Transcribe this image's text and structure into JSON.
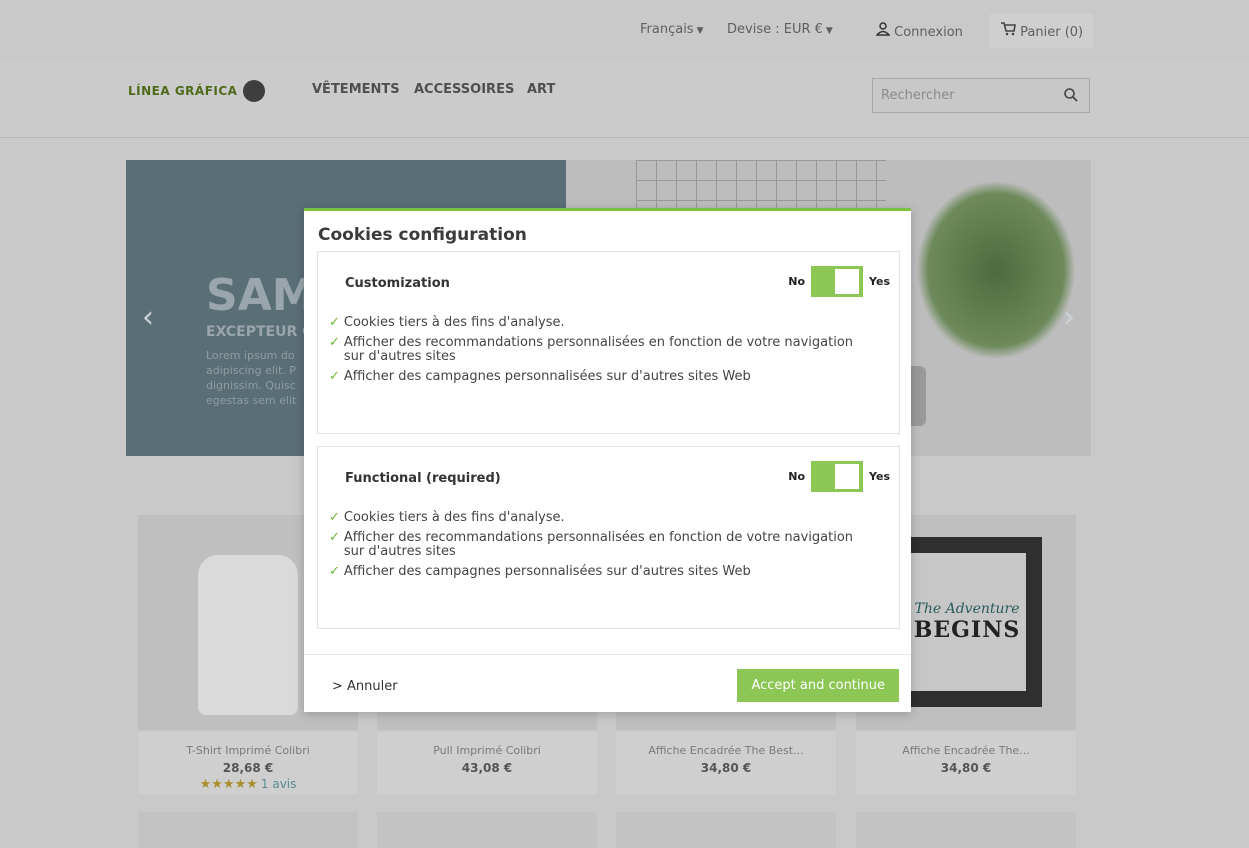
{
  "topbar": {
    "language": "Français",
    "currency": "Devise : EUR €",
    "login": "Connexion",
    "cart": "Panier (0)"
  },
  "header": {
    "logo_text": "LÍNEA GRÁFICA",
    "menu": [
      "VÊTEMENTS",
      "ACCESSOIRES",
      "ART"
    ],
    "search_placeholder": "Rechercher"
  },
  "hero": {
    "title": "SAM",
    "subtitle": "EXCEPTEUR C",
    "text": "Lorem ipsum do adipiscing elit. P dignissim. Quisc egestas sem elit"
  },
  "products": [
    {
      "name": "T-Shirt Imprimé Colibri",
      "price": "28,68 €",
      "stars": "★★★★★",
      "reviews": "1 avis"
    },
    {
      "name": "Pull Imprimé Colibri",
      "price": "43,08 €"
    },
    {
      "name": "Affiche Encadrée The Best...",
      "price": "34,80 €"
    },
    {
      "name": "Affiche Encadrée The...",
      "price": "34,80 €"
    }
  ],
  "poster": {
    "line1": "The Adventure",
    "line2": "BEGINS"
  },
  "modal": {
    "title": "Cookies configuration",
    "sections": [
      {
        "title": "Customization",
        "toggle_no": "No",
        "toggle_yes": "Yes",
        "items": [
          "Cookies tiers à des fins d'analyse.",
          "Afficher des recommandations personnalisées en fonction de votre navigation sur d'autres sites",
          "Afficher des campagnes personnalisées sur d'autres sites Web"
        ]
      },
      {
        "title": "Functional (required)",
        "toggle_no": "No",
        "toggle_yes": "Yes",
        "items": [
          "Cookies tiers à des fins d'analyse.",
          "Afficher des recommandations personnalisées en fonction de votre navigation sur d'autres sites",
          "Afficher des campagnes personnalisées sur d'autres sites Web"
        ]
      }
    ],
    "cancel": "> Annuler",
    "accept": "Accept and continue"
  },
  "colors": {
    "accent": "#8cc654",
    "check": "#6fb536",
    "overlay": "#c9c9c9"
  }
}
